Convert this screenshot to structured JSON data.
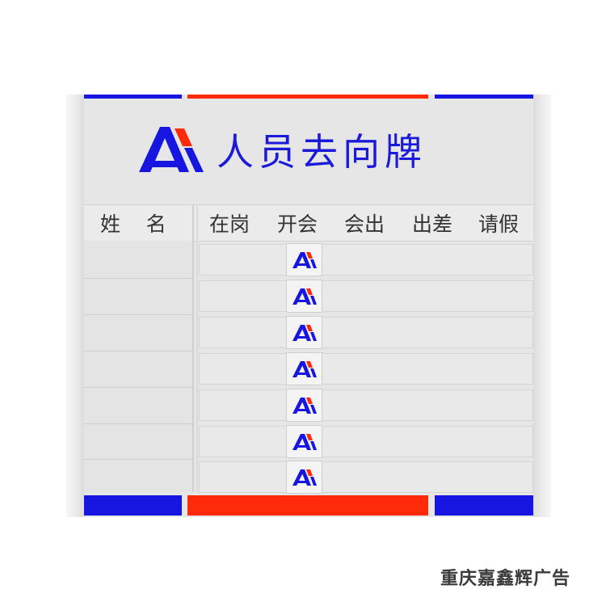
{
  "board": {
    "title": "人员去向牌",
    "name_header": "姓    名",
    "status_headers": [
      "在岗",
      "开会",
      "会出",
      "出差",
      "请假"
    ],
    "row_count": 7,
    "logo_icon": "ai-logo-icon",
    "colors": {
      "blue": "#1616e0",
      "red": "#ff2a0a",
      "title_blue": "#1a1ad8",
      "panel_gray": "#e6e6e6"
    }
  },
  "watermark": "重庆嘉鑫辉广告"
}
